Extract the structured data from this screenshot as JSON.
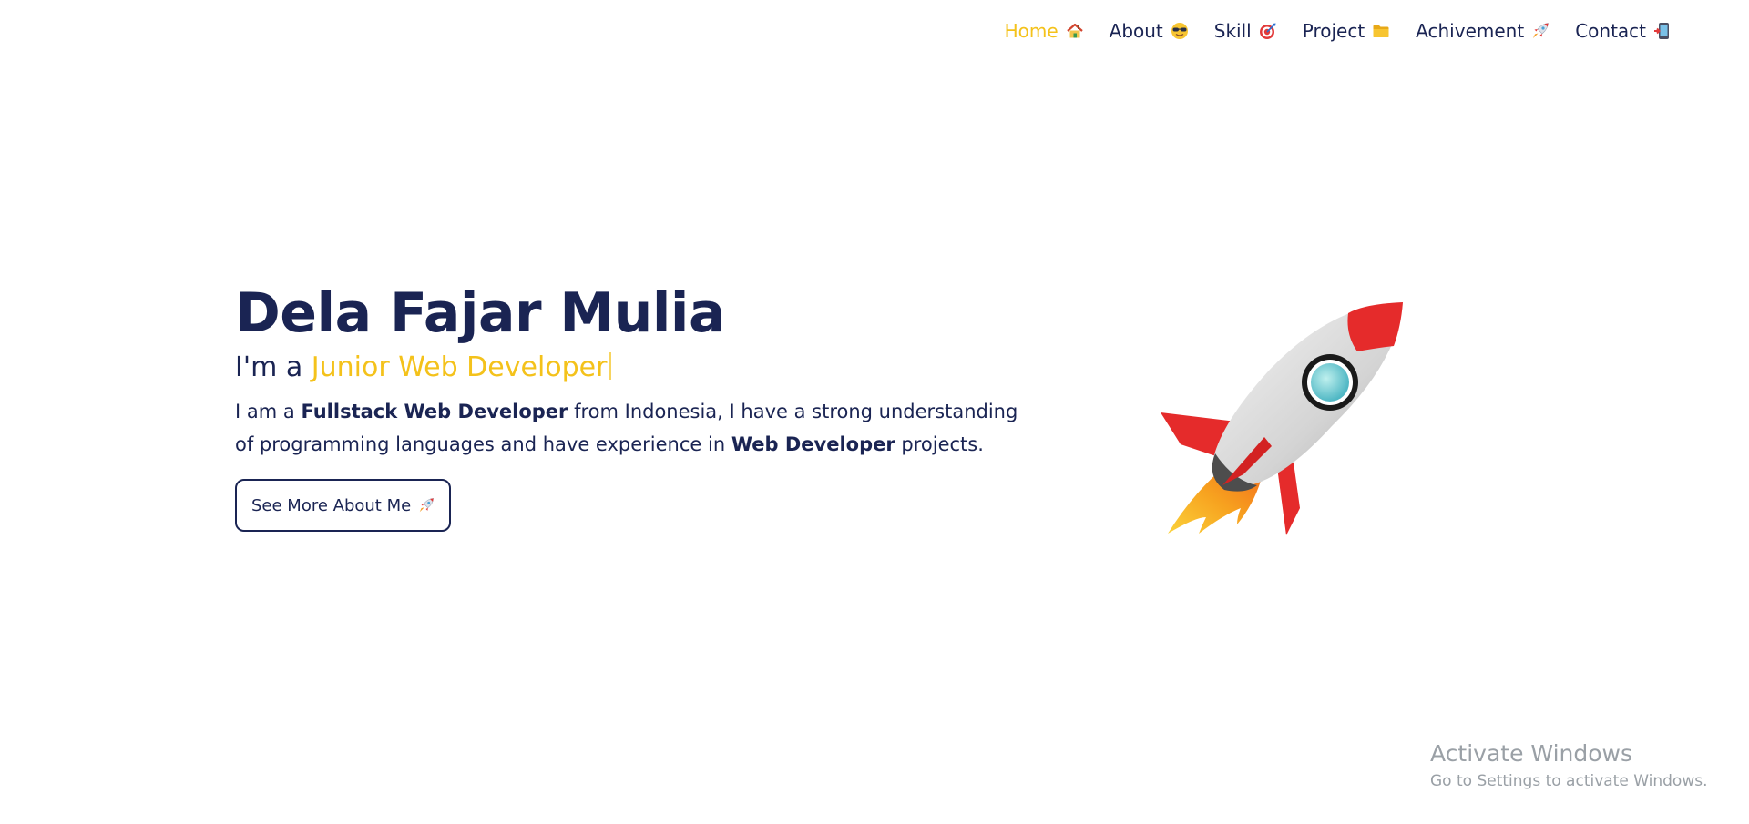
{
  "nav": {
    "items": [
      {
        "label": "Home",
        "icon": "house-icon",
        "active": true
      },
      {
        "label": "About",
        "icon": "sunglasses-face-icon",
        "active": false
      },
      {
        "label": "Skill",
        "icon": "target-icon",
        "active": false
      },
      {
        "label": "Project",
        "icon": "folder-icon",
        "active": false
      },
      {
        "label": "Achivement",
        "icon": "rocket-icon",
        "active": false
      },
      {
        "label": "Contact",
        "icon": "mobile-phone-icon",
        "active": false
      }
    ]
  },
  "hero": {
    "name": "Dela Fajar Mulia",
    "role_prefix": "I'm a",
    "role_text": "Junior Web Developer",
    "desc": {
      "p1": "I am a",
      "b1": "Fullstack Web Developer",
      "p2": "from Indonesia, I have a strong understanding of programming languages and have experience in",
      "b2": "Web Developer",
      "p3": "projects."
    },
    "cta_label": "See More About Me",
    "cta_icon": "rocket-icon",
    "illustration": "rocket-illustration"
  },
  "watermark": {
    "title": "Activate Windows",
    "subtitle": "Go to Settings to activate Windows."
  },
  "colors": {
    "primary": "#1a2453",
    "accent": "#f4c21b",
    "rocket_red": "#e52b2b"
  }
}
